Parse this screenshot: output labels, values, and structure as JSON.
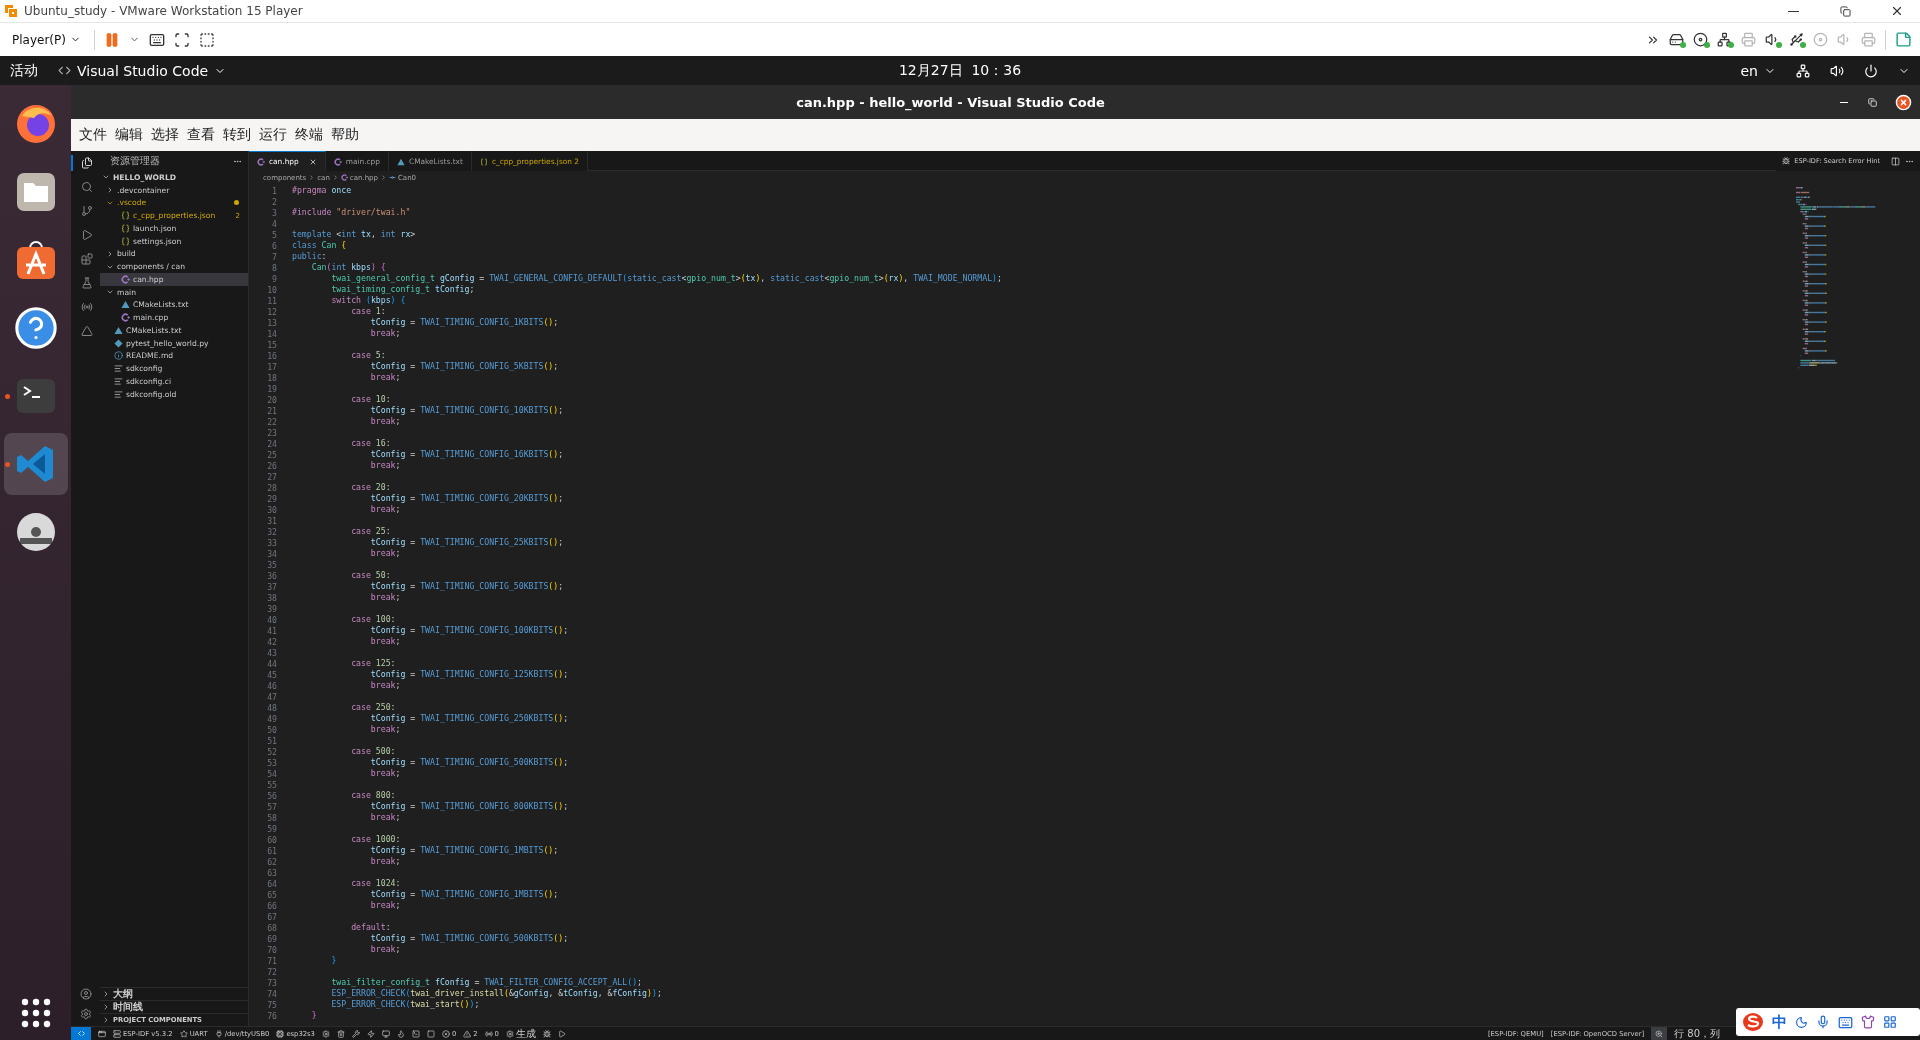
{
  "vm_window": {
    "title": "Ubuntu_study - VMware Workstation 15 Player",
    "player_menu": "Player(P)",
    "devices": [
      {
        "kind": "drive",
        "connected": true
      },
      {
        "kind": "disc",
        "connected": true
      },
      {
        "kind": "network",
        "connected": true
      },
      {
        "kind": "printer",
        "connected": false
      },
      {
        "kind": "sound",
        "connected": true
      },
      {
        "kind": "usb",
        "connected": true
      },
      {
        "kind": "disc",
        "connected": false
      },
      {
        "kind": "sound",
        "connected": false
      },
      {
        "kind": "printer",
        "connected": false
      }
    ]
  },
  "ubuntu_bar": {
    "activities": "活动",
    "app": "Visual Studio Code",
    "clock": "12月27日  10：36",
    "language": "en"
  },
  "dock": [
    {
      "kind": "browser",
      "running": false,
      "selected": false
    },
    {
      "kind": "files",
      "running": false,
      "selected": false
    },
    {
      "kind": "store",
      "running": false,
      "selected": false
    },
    {
      "kind": "help",
      "running": false,
      "selected": false
    },
    {
      "kind": "terminal",
      "running": true,
      "selected": false
    },
    {
      "kind": "editor",
      "running": true,
      "selected": true
    },
    {
      "kind": "disc",
      "running": false,
      "selected": false
    }
  ],
  "vscode": {
    "title": "can.hpp - hello_world - Visual Studio Code",
    "menu": [
      "文件",
      "编辑",
      "选择",
      "查看",
      "转到",
      "运行",
      "终端",
      "帮助"
    ],
    "activity_bar": [
      {
        "kind": "files",
        "selected": true
      },
      {
        "kind": "search",
        "selected": false
      },
      {
        "kind": "git",
        "selected": false
      },
      {
        "kind": "debug",
        "selected": false
      },
      {
        "kind": "extensions",
        "selected": false
      },
      {
        "kind": "testing",
        "selected": false
      },
      {
        "kind": "esp",
        "selected": false
      },
      {
        "kind": "triangle",
        "selected": false
      }
    ],
    "explorer": {
      "title": "资源管理器",
      "root": {
        "name": "HELLO_WORLD",
        "expanded": true,
        "children": [
          {
            "name": ".devcontainer",
            "kind": "folder",
            "expanded": false,
            "selected": false,
            "warning": false
          },
          {
            "name": ".vscode",
            "kind": "folder",
            "expanded": true,
            "selected": false,
            "warning": true,
            "children": [
              {
                "name": "c_cpp_properties.json",
                "kind": "json",
                "selected": false,
                "warning": true,
                "badge": "2"
              },
              {
                "name": "launch.json",
                "kind": "json",
                "selected": false,
                "warning": false
              },
              {
                "name": "settings.json",
                "kind": "json",
                "selected": false,
                "warning": false
              }
            ]
          },
          {
            "name": "build",
            "kind": "folder",
            "expanded": false,
            "selected": false,
            "warning": false
          },
          {
            "name": "components / can",
            "kind": "folder",
            "expanded": true,
            "selected": false,
            "warning": false,
            "children": [
              {
                "name": "can.hpp",
                "kind": "cpp",
                "selected": true,
                "warning": false
              }
            ]
          },
          {
            "name": "main",
            "kind": "folder",
            "expanded": true,
            "selected": false,
            "warning": false,
            "children": [
              {
                "name": "CMakeLists.txt",
                "kind": "cmake",
                "selected": false,
                "warning": false
              },
              {
                "name": "main.cpp",
                "kind": "cpp",
                "selected": false,
                "warning": false
              }
            ]
          },
          {
            "name": "CMakeLists.txt",
            "kind": "cmake",
            "selected": false,
            "warning": false
          },
          {
            "name": "pytest_hello_world.py",
            "kind": "python",
            "selected": false,
            "warning": false
          },
          {
            "name": "README.md",
            "kind": "info",
            "selected": false,
            "warning": false
          },
          {
            "name": "sdkconfig",
            "kind": "config",
            "selected": false,
            "warning": false
          },
          {
            "name": "sdkconfig.ci",
            "kind": "config",
            "selected": false,
            "warning": false
          },
          {
            "name": "sdkconfig.old",
            "kind": "config",
            "selected": false,
            "warning": false
          }
        ]
      },
      "sections": [
        {
          "name": "大纲",
          "expanded": false
        },
        {
          "name": "时间线",
          "expanded": false
        },
        {
          "name": "PROJECT COMPONENTS",
          "expanded": false
        }
      ]
    },
    "tabs": [
      {
        "label": "can.hpp",
        "kind": "cpp",
        "selected": true,
        "warning": false
      },
      {
        "label": "main.cpp",
        "kind": "cpp",
        "selected": false,
        "warning": false
      },
      {
        "label": "CMakeLists.txt",
        "kind": "cmake",
        "selected": false,
        "warning": false
      },
      {
        "label": "c_cpp_properties.json 2",
        "kind": "json",
        "selected": false,
        "warning": true
      }
    ],
    "editor_hint": "ESP-IDF: Search Error Hint",
    "breadcrumb": [
      {
        "label": "components",
        "kind": "folder"
      },
      {
        "label": "can",
        "kind": "folder"
      },
      {
        "label": "can.hpp",
        "kind": "cpp"
      },
      {
        "label": "Can0",
        "kind": "symbol"
      }
    ],
    "code": [
      {
        "number": "1",
        "tokens": [
          {
            "kind": "pp",
            "text": "#pragma"
          },
          {
            "kind": "var",
            "text": " once"
          }
        ]
      },
      {
        "number": "2"
      },
      {
        "number": "3",
        "tokens": [
          {
            "kind": "pp",
            "text": "#include"
          },
          {
            "kind": "str",
            "text": " \"driver/twai.h\""
          }
        ]
      },
      {
        "number": "4"
      },
      {
        "number": "5",
        "tokens": [
          {
            "kind": "kw",
            "text": "template"
          },
          {
            "kind": "p",
            "text": " <"
          },
          {
            "kind": "kw",
            "text": "int"
          },
          {
            "kind": "var",
            "text": " tx"
          },
          {
            "kind": "p",
            "text": ", "
          },
          {
            "kind": "kw",
            "text": "int"
          },
          {
            "kind": "var",
            "text": " rx"
          },
          {
            "kind": "p",
            "text": ">"
          }
        ]
      },
      {
        "number": "6",
        "tokens": [
          {
            "kind": "kw",
            "text": "class"
          },
          {
            "kind": "type",
            "text": " Can"
          },
          {
            "kind": "b1",
            "text": " {"
          }
        ]
      },
      {
        "number": "7",
        "tokens": [
          {
            "kind": "kw",
            "text": "public"
          },
          {
            "kind": "p",
            "text": ":"
          }
        ]
      },
      {
        "number": "8",
        "tokens": [
          {
            "kind": "type",
            "text": "    Can"
          },
          {
            "kind": "b2",
            "text": "("
          },
          {
            "kind": "kw",
            "text": "int"
          },
          {
            "kind": "var",
            "text": " kbps"
          },
          {
            "kind": "b2",
            "text": ")"
          },
          {
            "kind": "b2",
            "text": " {"
          }
        ]
      },
      {
        "number": "9",
        "tokens": [
          {
            "kind": "type",
            "text": "        twai_general_config_t"
          },
          {
            "kind": "var",
            "text": " gConfig"
          },
          {
            "kind": "p",
            "text": " = "
          },
          {
            "kind": "macro",
            "text": "TWAI_GENERAL_CONFIG_DEFAULT"
          },
          {
            "kind": "b3",
            "text": "("
          },
          {
            "kind": "kw",
            "text": "static_cast"
          },
          {
            "kind": "p",
            "text": "<"
          },
          {
            "kind": "type",
            "text": "gpio_num_t"
          },
          {
            "kind": "p",
            "text": ">"
          },
          {
            "kind": "b1",
            "text": "("
          },
          {
            "kind": "var",
            "text": "tx"
          },
          {
            "kind": "b1",
            "text": ")"
          },
          {
            "kind": "p",
            "text": ", "
          },
          {
            "kind": "kw",
            "text": "static_cast"
          },
          {
            "kind": "p",
            "text": "<"
          },
          {
            "kind": "type",
            "text": "gpio_num_t"
          },
          {
            "kind": "p",
            "text": ">"
          },
          {
            "kind": "b1",
            "text": "("
          },
          {
            "kind": "var",
            "text": "rx"
          },
          {
            "kind": "b1",
            "text": ")"
          },
          {
            "kind": "p",
            "text": ", "
          },
          {
            "kind": "macro",
            "text": "TWAI_MODE_NORMAL"
          },
          {
            "kind": "b3",
            "text": ")"
          },
          {
            "kind": "p",
            "text": ";"
          }
        ]
      },
      {
        "number": "10",
        "tokens": [
          {
            "kind": "type",
            "text": "        twai_timing_config_t"
          },
          {
            "kind": "var",
            "text": " tConfig"
          },
          {
            "kind": "p",
            "text": ";"
          }
        ]
      },
      {
        "number": "11",
        "tokens": [
          {
            "kind": "ctl",
            "text": "        switch"
          },
          {
            "kind": "b3",
            "text": " ("
          },
          {
            "kind": "var",
            "text": "kbps"
          },
          {
            "kind": "b3",
            "text": ")"
          },
          {
            "kind": "b3",
            "text": " {"
          }
        ]
      },
      {
        "number": "12",
        "tokens": [
          {
            "kind": "ctl",
            "text": "            case"
          },
          {
            "kind": "num",
            "text": " 1"
          },
          {
            "kind": "p",
            "text": ":"
          }
        ]
      },
      {
        "number": "13",
        "tokens": [
          {
            "kind": "var",
            "text": "                tConfig"
          },
          {
            "kind": "p",
            "text": " = "
          },
          {
            "kind": "macro",
            "text": "TWAI_TIMING_CONFIG_1KBITS"
          },
          {
            "kind": "b1",
            "text": "()"
          },
          {
            "kind": "p",
            "text": ";"
          }
        ]
      },
      {
        "number": "14",
        "tokens": [
          {
            "kind": "ctl",
            "text": "                break"
          },
          {
            "kind": "p",
            "text": ";"
          }
        ]
      },
      {
        "number": "15"
      },
      {
        "number": "16",
        "tokens": [
          {
            "kind": "ctl",
            "text": "            case"
          },
          {
            "kind": "num",
            "text": " 5"
          },
          {
            "kind": "p",
            "text": ":"
          }
        ]
      },
      {
        "number": "17",
        "tokens": [
          {
            "kind": "var",
            "text": "                tConfig"
          },
          {
            "kind": "p",
            "text": " = "
          },
          {
            "kind": "macro",
            "text": "TWAI_TIMING_CONFIG_5KBITS"
          },
          {
            "kind": "b1",
            "text": "()"
          },
          {
            "kind": "p",
            "text": ";"
          }
        ]
      },
      {
        "number": "18",
        "tokens": [
          {
            "kind": "ctl",
            "text": "                break"
          },
          {
            "kind": "p",
            "text": ";"
          }
        ]
      },
      {
        "number": "19"
      },
      {
        "number": "20",
        "tokens": [
          {
            "kind": "ctl",
            "text": "            case"
          },
          {
            "kind": "num",
            "text": " 10"
          },
          {
            "kind": "p",
            "text": ":"
          }
        ]
      },
      {
        "number": "21",
        "tokens": [
          {
            "kind": "var",
            "text": "                tConfig"
          },
          {
            "kind": "p",
            "text": " = "
          },
          {
            "kind": "macro",
            "text": "TWAI_TIMING_CONFIG_10KBITS"
          },
          {
            "kind": "b1",
            "text": "()"
          },
          {
            "kind": "p",
            "text": ";"
          }
        ]
      },
      {
        "number": "22",
        "tokens": [
          {
            "kind": "ctl",
            "text": "                break"
          },
          {
            "kind": "p",
            "text": ";"
          }
        ]
      },
      {
        "number": "23"
      },
      {
        "number": "24",
        "tokens": [
          {
            "kind": "ctl",
            "text": "            case"
          },
          {
            "kind": "num",
            "text": " 16"
          },
          {
            "kind": "p",
            "text": ":"
          }
        ]
      },
      {
        "number": "25",
        "tokens": [
          {
            "kind": "var",
            "text": "                tConfig"
          },
          {
            "kind": "p",
            "text": " = "
          },
          {
            "kind": "macro",
            "text": "TWAI_TIMING_CONFIG_16KBITS"
          },
          {
            "kind": "b1",
            "text": "()"
          },
          {
            "kind": "p",
            "text": ";"
          }
        ]
      },
      {
        "number": "26",
        "tokens": [
          {
            "kind": "ctl",
            "text": "                break"
          },
          {
            "kind": "p",
            "text": ";"
          }
        ]
      },
      {
        "number": "27"
      },
      {
        "number": "28",
        "tokens": [
          {
            "kind": "ctl",
            "text": "            case"
          },
          {
            "kind": "num",
            "text": " 20"
          },
          {
            "kind": "p",
            "text": ":"
          }
        ]
      },
      {
        "number": "29",
        "tokens": [
          {
            "kind": "var",
            "text": "                tConfig"
          },
          {
            "kind": "p",
            "text": " = "
          },
          {
            "kind": "macro",
            "text": "TWAI_TIMING_CONFIG_20KBITS"
          },
          {
            "kind": "b1",
            "text": "()"
          },
          {
            "kind": "p",
            "text": ";"
          }
        ]
      },
      {
        "number": "30",
        "tokens": [
          {
            "kind": "ctl",
            "text": "                break"
          },
          {
            "kind": "p",
            "text": ";"
          }
        ]
      },
      {
        "number": "31"
      },
      {
        "number": "32",
        "tokens": [
          {
            "kind": "ctl",
            "text": "            case"
          },
          {
            "kind": "num",
            "text": " 25"
          },
          {
            "kind": "p",
            "text": ":"
          }
        ]
      },
      {
        "number": "33",
        "tokens": [
          {
            "kind": "var",
            "text": "                tConfig"
          },
          {
            "kind": "p",
            "text": " = "
          },
          {
            "kind": "macro",
            "text": "TWAI_TIMING_CONFIG_25KBITS"
          },
          {
            "kind": "b1",
            "text": "()"
          },
          {
            "kind": "p",
            "text": ";"
          }
        ]
      },
      {
        "number": "34",
        "tokens": [
          {
            "kind": "ctl",
            "text": "                break"
          },
          {
            "kind": "p",
            "text": ";"
          }
        ]
      },
      {
        "number": "35"
      },
      {
        "number": "36",
        "tokens": [
          {
            "kind": "ctl",
            "text": "            case"
          },
          {
            "kind": "num",
            "text": " 50"
          },
          {
            "kind": "p",
            "text": ":"
          }
        ]
      },
      {
        "number": "37",
        "tokens": [
          {
            "kind": "var",
            "text": "                tConfig"
          },
          {
            "kind": "p",
            "text": " = "
          },
          {
            "kind": "macro",
            "text": "TWAI_TIMING_CONFIG_50KBITS"
          },
          {
            "kind": "b1",
            "text": "()"
          },
          {
            "kind": "p",
            "text": ";"
          }
        ]
      },
      {
        "number": "38",
        "tokens": [
          {
            "kind": "ctl",
            "text": "                break"
          },
          {
            "kind": "p",
            "text": ";"
          }
        ]
      },
      {
        "number": "39"
      },
      {
        "number": "40",
        "tokens": [
          {
            "kind": "ctl",
            "text": "            case"
          },
          {
            "kind": "num",
            "text": " 100"
          },
          {
            "kind": "p",
            "text": ":"
          }
        ]
      },
      {
        "number": "41",
        "tokens": [
          {
            "kind": "var",
            "text": "                tConfig"
          },
          {
            "kind": "p",
            "text": " = "
          },
          {
            "kind": "macro",
            "text": "TWAI_TIMING_CONFIG_100KBITS"
          },
          {
            "kind": "b1",
            "text": "()"
          },
          {
            "kind": "p",
            "text": ";"
          }
        ]
      },
      {
        "number": "42",
        "tokens": [
          {
            "kind": "ctl",
            "text": "                break"
          },
          {
            "kind": "p",
            "text": ";"
          }
        ]
      },
      {
        "number": "43"
      },
      {
        "number": "44",
        "tokens": [
          {
            "kind": "ctl",
            "text": "            case"
          },
          {
            "kind": "num",
            "text": " 125"
          },
          {
            "kind": "p",
            "text": ":"
          }
        ]
      },
      {
        "number": "45",
        "tokens": [
          {
            "kind": "var",
            "text": "                tConfig"
          },
          {
            "kind": "p",
            "text": " = "
          },
          {
            "kind": "macro",
            "text": "TWAI_TIMING_CONFIG_125KBITS"
          },
          {
            "kind": "b1",
            "text": "()"
          },
          {
            "kind": "p",
            "text": ";"
          }
        ]
      },
      {
        "number": "46",
        "tokens": [
          {
            "kind": "ctl",
            "text": "                break"
          },
          {
            "kind": "p",
            "text": ";"
          }
        ]
      },
      {
        "number": "47"
      },
      {
        "number": "48",
        "tokens": [
          {
            "kind": "ctl",
            "text": "            case"
          },
          {
            "kind": "num",
            "text": " 250"
          },
          {
            "kind": "p",
            "text": ":"
          }
        ]
      },
      {
        "number": "49",
        "tokens": [
          {
            "kind": "var",
            "text": "                tConfig"
          },
          {
            "kind": "p",
            "text": " = "
          },
          {
            "kind": "macro",
            "text": "TWAI_TIMING_CONFIG_250KBITS"
          },
          {
            "kind": "b1",
            "text": "()"
          },
          {
            "kind": "p",
            "text": ";"
          }
        ]
      },
      {
        "number": "50",
        "tokens": [
          {
            "kind": "ctl",
            "text": "                break"
          },
          {
            "kind": "p",
            "text": ";"
          }
        ]
      },
      {
        "number": "51"
      },
      {
        "number": "52",
        "tokens": [
          {
            "kind": "ctl",
            "text": "            case"
          },
          {
            "kind": "num",
            "text": " 500"
          },
          {
            "kind": "p",
            "text": ":"
          }
        ]
      },
      {
        "number": "53",
        "tokens": [
          {
            "kind": "var",
            "text": "                tConfig"
          },
          {
            "kind": "p",
            "text": " = "
          },
          {
            "kind": "macro",
            "text": "TWAI_TIMING_CONFIG_500KBITS"
          },
          {
            "kind": "b1",
            "text": "()"
          },
          {
            "kind": "p",
            "text": ";"
          }
        ]
      },
      {
        "number": "54",
        "tokens": [
          {
            "kind": "ctl",
            "text": "                break"
          },
          {
            "kind": "p",
            "text": ";"
          }
        ]
      },
      {
        "number": "55"
      },
      {
        "number": "56",
        "tokens": [
          {
            "kind": "ctl",
            "text": "            case"
          },
          {
            "kind": "num",
            "text": " 800"
          },
          {
            "kind": "p",
            "text": ":"
          }
        ]
      },
      {
        "number": "57",
        "tokens": [
          {
            "kind": "var",
            "text": "                tConfig"
          },
          {
            "kind": "p",
            "text": " = "
          },
          {
            "kind": "macro",
            "text": "TWAI_TIMING_CONFIG_800KBITS"
          },
          {
            "kind": "b1",
            "text": "()"
          },
          {
            "kind": "p",
            "text": ";"
          }
        ]
      },
      {
        "number": "58",
        "tokens": [
          {
            "kind": "ctl",
            "text": "                break"
          },
          {
            "kind": "p",
            "text": ";"
          }
        ]
      },
      {
        "number": "59"
      },
      {
        "number": "60",
        "tokens": [
          {
            "kind": "ctl",
            "text": "            case"
          },
          {
            "kind": "num",
            "text": " 1000"
          },
          {
            "kind": "p",
            "text": ":"
          }
        ]
      },
      {
        "number": "61",
        "tokens": [
          {
            "kind": "var",
            "text": "                tConfig"
          },
          {
            "kind": "p",
            "text": " = "
          },
          {
            "kind": "macro",
            "text": "TWAI_TIMING_CONFIG_1MBITS"
          },
          {
            "kind": "b1",
            "text": "()"
          },
          {
            "kind": "p",
            "text": ";"
          }
        ]
      },
      {
        "number": "62",
        "tokens": [
          {
            "kind": "ctl",
            "text": "                break"
          },
          {
            "kind": "p",
            "text": ";"
          }
        ]
      },
      {
        "number": "63"
      },
      {
        "number": "64",
        "tokens": [
          {
            "kind": "ctl",
            "text": "            case"
          },
          {
            "kind": "num",
            "text": " 1024"
          },
          {
            "kind": "p",
            "text": ":"
          }
        ]
      },
      {
        "number": "65",
        "tokens": [
          {
            "kind": "var",
            "text": "                tConfig"
          },
          {
            "kind": "p",
            "text": " = "
          },
          {
            "kind": "macro",
            "text": "TWAI_TIMING_CONFIG_1MBITS"
          },
          {
            "kind": "b1",
            "text": "()"
          },
          {
            "kind": "p",
            "text": ";"
          }
        ]
      },
      {
        "number": "66",
        "tokens": [
          {
            "kind": "ctl",
            "text": "                break"
          },
          {
            "kind": "p",
            "text": ";"
          }
        ]
      },
      {
        "number": "67"
      },
      {
        "number": "68",
        "tokens": [
          {
            "kind": "ctl",
            "text": "            default"
          },
          {
            "kind": "p",
            "text": ":"
          }
        ]
      },
      {
        "number": "69",
        "tokens": [
          {
            "kind": "var",
            "text": "                tConfig"
          },
          {
            "kind": "p",
            "text": " = "
          },
          {
            "kind": "macro",
            "text": "TWAI_TIMING_CONFIG_500KBITS"
          },
          {
            "kind": "b1",
            "text": "()"
          },
          {
            "kind": "p",
            "text": ";"
          }
        ]
      },
      {
        "number": "70",
        "tokens": [
          {
            "kind": "ctl",
            "text": "                break"
          },
          {
            "kind": "p",
            "text": ";"
          }
        ]
      },
      {
        "number": "71",
        "tokens": [
          {
            "kind": "b3",
            "text": "        }"
          }
        ]
      },
      {
        "number": "72"
      },
      {
        "number": "73",
        "tokens": [
          {
            "kind": "type",
            "text": "        twai_filter_config_t"
          },
          {
            "kind": "var",
            "text": " fConfig"
          },
          {
            "kind": "p",
            "text": " = "
          },
          {
            "kind": "macro",
            "text": "TWAI_FILTER_CONFIG_ACCEPT_ALL"
          },
          {
            "kind": "b3",
            "text": "()"
          },
          {
            "kind": "p",
            "text": ";"
          }
        ]
      },
      {
        "number": "74",
        "tokens": [
          {
            "kind": "macro",
            "text": "        ESP_ERROR_CHECK"
          },
          {
            "kind": "b3",
            "text": "("
          },
          {
            "kind": "fn",
            "text": "twai_driver_install"
          },
          {
            "kind": "b1",
            "text": "("
          },
          {
            "kind": "p",
            "text": "&"
          },
          {
            "kind": "var",
            "text": "gConfig"
          },
          {
            "kind": "p",
            "text": ", &"
          },
          {
            "kind": "var",
            "text": "tConfig"
          },
          {
            "kind": "p",
            "text": ", &"
          },
          {
            "kind": "var",
            "text": "fConfig"
          },
          {
            "kind": "b1",
            "text": ")"
          },
          {
            "kind": "b3",
            "text": ")"
          },
          {
            "kind": "p",
            "text": ";"
          }
        ]
      },
      {
        "number": "75",
        "tokens": [
          {
            "kind": "macro",
            "text": "        ESP_ERROR_CHECK"
          },
          {
            "kind": "b3",
            "text": "("
          },
          {
            "kind": "fn",
            "text": "twai_start"
          },
          {
            "kind": "b1",
            "text": "()"
          },
          {
            "kind": "b3",
            "text": ")"
          },
          {
            "kind": "p",
            "text": ";"
          }
        ]
      },
      {
        "number": "76",
        "tokens": [
          {
            "kind": "b2",
            "text": "    }"
          }
        ]
      }
    ],
    "status_left": [
      {
        "kind": "remote"
      },
      {
        "kind": "window"
      },
      {
        "kind": "idf",
        "text": "ESP-IDF v5.3.2"
      },
      {
        "kind": "uart",
        "text": "UART"
      },
      {
        "kind": "port",
        "text": "/dev/ttyUSB0"
      },
      {
        "kind": "chip",
        "text": "esp32s3"
      },
      {
        "kind": "gear"
      },
      {
        "kind": "trash"
      },
      {
        "kind": "wrench"
      },
      {
        "kind": "flash"
      },
      {
        "kind": "monitor"
      },
      {
        "kind": "flame"
      },
      {
        "kind": "terminal"
      },
      {
        "kind": "stop"
      },
      {
        "kind": "error",
        "text": "0"
      },
      {
        "kind": "warning",
        "text": "2"
      },
      {
        "kind": "radio",
        "text": "0"
      },
      {
        "kind": "build",
        "text": "生成"
      },
      {
        "kind": "debug"
      },
      {
        "kind": "run"
      }
    ],
    "status_right": [
      {
        "kind": "plain",
        "text": "[ESP-IDF: QEMU]"
      },
      {
        "kind": "plain",
        "text": "[ESP-IDF: OpenOCD Server]"
      },
      {
        "kind": "zoom"
      },
      {
        "kind": "plain",
        "text": "行 80，列"
      }
    ]
  },
  "ime_toolbar": {
    "mode": "中"
  }
}
